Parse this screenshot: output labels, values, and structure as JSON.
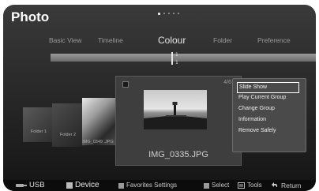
{
  "app_title": "Photo",
  "tabs": [
    {
      "label": "Basic View",
      "active": false
    },
    {
      "label": "Timeline",
      "active": false
    },
    {
      "label": "Colour",
      "active": true
    },
    {
      "label": "Folder",
      "active": false
    },
    {
      "label": "Preference",
      "active": false
    }
  ],
  "timeline": {
    "marker_top": "1",
    "marker_bottom": "1"
  },
  "thumbnails": [
    {
      "label": "Folder 1"
    },
    {
      "label": "Folder 2"
    },
    {
      "label": "IMG_0349 .JPG"
    }
  ],
  "preview": {
    "counter": "4/6",
    "file_name": "IMG_0335.JPG"
  },
  "context_menu": {
    "items": [
      "Slide Show",
      "Play Current Group",
      "Change Group",
      "Information",
      "Remove Safely"
    ],
    "selected_index": 0
  },
  "bottom_bar": {
    "usb_label": "USB",
    "device_label": "Device",
    "favorites_label": "Favorites Settings",
    "select_label": "Select",
    "tools_label": "Tools",
    "return_label": "Return"
  },
  "colors": {
    "accent": "#ffffff",
    "background": "#2b2b2b"
  },
  "icons": [
    "usb-icon",
    "device-square-icon",
    "favorites-square-icon",
    "select-square-icon",
    "tools-icon",
    "return-icon"
  ]
}
